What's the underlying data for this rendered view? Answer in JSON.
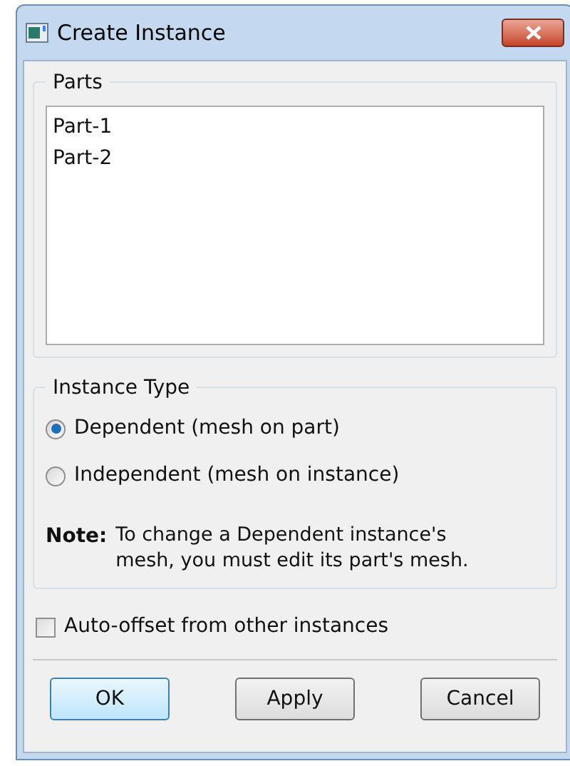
{
  "window": {
    "title": "Create Instance"
  },
  "parts": {
    "title": "Parts",
    "items": [
      {
        "label": "Part-1",
        "selected": false
      },
      {
        "label": "Part-2",
        "selected": false
      }
    ]
  },
  "instance_type": {
    "title": "Instance Type",
    "options": [
      {
        "label": "Dependent (mesh on part)",
        "selected": true
      },
      {
        "label": "Independent (mesh on instance)",
        "selected": false
      }
    ],
    "note_label": "Note:",
    "note_text": "To change a Dependent instance's mesh, you must edit its part's mesh."
  },
  "auto_offset": {
    "label": "Auto-offset from other instances",
    "checked": false
  },
  "buttons": [
    {
      "label": "OK",
      "default": true
    },
    {
      "label": "Apply",
      "default": false
    },
    {
      "label": "Cancel",
      "default": false
    }
  ]
}
